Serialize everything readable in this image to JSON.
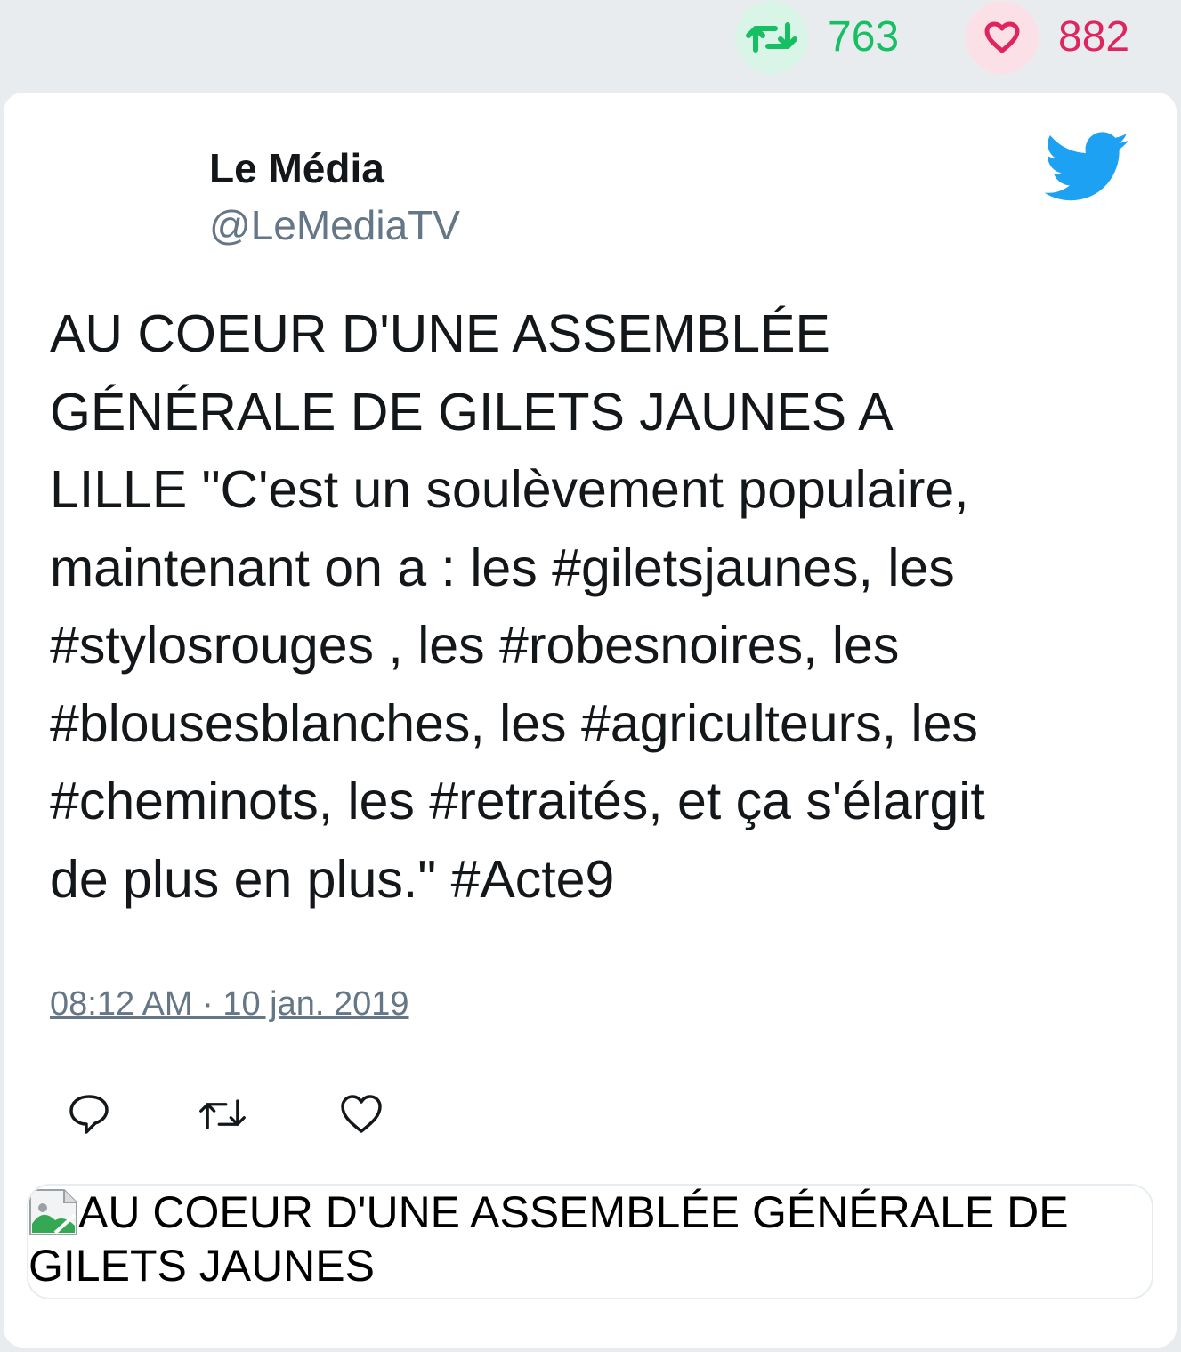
{
  "stats": {
    "retweet_count": "763",
    "like_count": "882"
  },
  "author": {
    "name": "Le Média",
    "handle": "@LeMediaTV"
  },
  "tweet": {
    "text": "AU COEUR D'UNE ASSEMBLÉE\nGÉNÉRALE DE GILETS JAUNES A\nLILLE \"C'est un soulèvement populaire,\nmaintenant on a : les #giletsjaunes, les\n#stylosrouges , les #robesnoires, les\n#blousesblanches, les #agriculteurs, les\n#cheminots, les #retraités, et ça s'élargit\nde plus en plus.\" #Acte9",
    "timestamp": "08:12 AM · 10 jan. 2019"
  },
  "embed": {
    "alt_text": "AU COEUR D'UNE ASSEMBLÉE GÉNÉRALE DE GILETS JAUNES"
  },
  "icons": {
    "retweet": "retweet-icon",
    "like": "heart-icon",
    "reply": "reply-icon",
    "brand": "twitter-bird-icon",
    "broken_image": "broken-image-icon"
  },
  "colors": {
    "retweet_green": "#17bf63",
    "like_red": "#e0245e",
    "twitter_blue": "#1da1f2",
    "muted_gray": "#657786",
    "page_bg": "#e9ecef"
  }
}
